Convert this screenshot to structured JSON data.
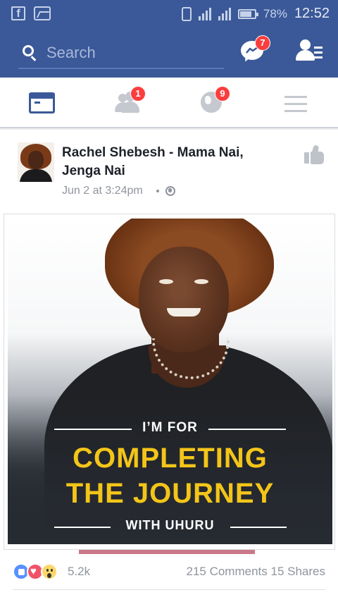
{
  "status_bar": {
    "battery": "78%",
    "time": "12:52",
    "icons": [
      "facebook-notification-icon",
      "gallery-notification-icon",
      "vibrate-icon",
      "signal-icon",
      "signal-e-icon",
      "battery-icon"
    ]
  },
  "header": {
    "search_placeholder": "Search",
    "messenger_badge": "7",
    "icons": [
      "search-icon",
      "messenger-icon",
      "friend-requests-icon"
    ]
  },
  "tabs": [
    {
      "name": "news-feed",
      "icon": "news-feed-icon",
      "badge": "",
      "active": true
    },
    {
      "name": "friends",
      "icon": "friends-icon",
      "badge": "1",
      "active": false
    },
    {
      "name": "notifications",
      "icon": "globe-icon",
      "badge": "9",
      "active": false
    },
    {
      "name": "menu",
      "icon": "menu-icon",
      "badge": "",
      "active": false
    }
  ],
  "post": {
    "author": "Rachel Shebesh - Mama Nai, Jenga Nai",
    "timestamp": "Jun 2 at 3:24pm",
    "privacy_icon": "globe-icon",
    "image_text": {
      "line1": "I’M FOR",
      "line2": "COMPLETING",
      "line3": "THE JOURNEY",
      "line4": "WITH UHURU"
    },
    "reactions": [
      "like",
      "love",
      "wow"
    ],
    "reaction_count": "5.2k",
    "comments": "215 Comments",
    "shares": "15 Shares"
  },
  "colors": {
    "brand_blue": "#3b5998",
    "badge_red": "#fa3e3e",
    "headline_yellow": "#f3c519",
    "meta_gray": "#90949c"
  }
}
